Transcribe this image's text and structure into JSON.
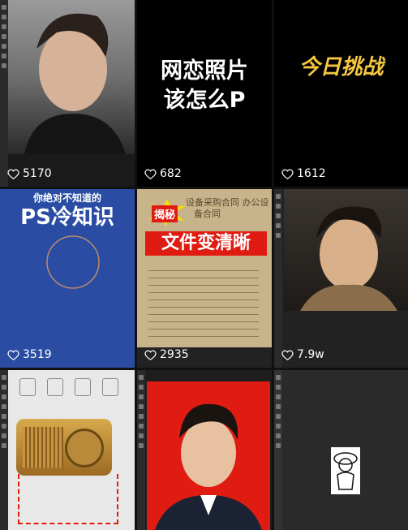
{
  "tiles": [
    {
      "likes": "5170"
    },
    {
      "title_line1": "网恋照片",
      "title_line2": "该怎么P",
      "likes": "682"
    },
    {
      "title": "今日挑战",
      "likes": "1612"
    },
    {
      "subtitle": "你绝对不知道的",
      "title": "PS冷知识",
      "likes": "3519"
    },
    {
      "badge": "揭秘",
      "banner": "文件变清晰",
      "doc_line1": "设备采购合同 办公设",
      "doc_line2": "备合同",
      "likes": "2935"
    },
    {
      "likes": "7.9w"
    },
    {
      "likes": ""
    },
    {
      "likes": ""
    },
    {
      "likes": ""
    }
  ],
  "colors": {
    "heart": "#ffffff",
    "likes_text": "#ffffff",
    "ps_blue": "#2a4da3",
    "paper": "#c8b48a",
    "red": "#e01c12",
    "gold": "#f5c842"
  }
}
